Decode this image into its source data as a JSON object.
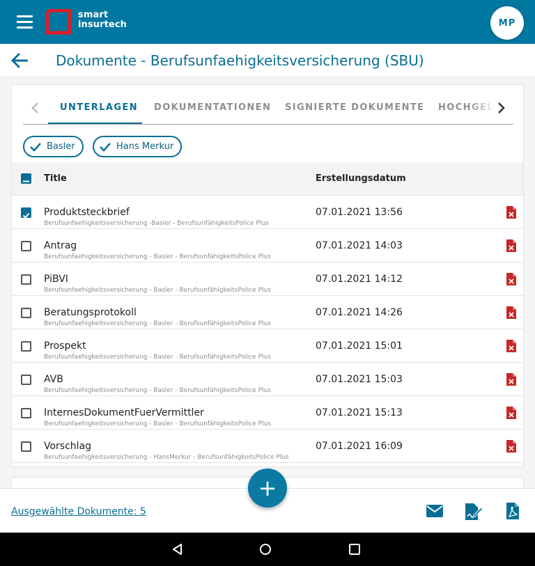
{
  "header": {
    "logo_line1": "smart",
    "logo_line2": "insurtech",
    "avatar_initials": "MP"
  },
  "page": {
    "title": "Dokumente - Berufsunfaehigkeitsversicherung (SBU)"
  },
  "tabs": [
    {
      "label": "UNTERLAGEN",
      "active": true
    },
    {
      "label": "DOKUMENTATIONEN",
      "active": false
    },
    {
      "label": "SIGNIERTE DOKUMENTE",
      "active": false
    },
    {
      "label": "HOCHGEL",
      "active": false
    }
  ],
  "filters": [
    {
      "label": "Basler",
      "checked": true
    },
    {
      "label": "Hans Merkur",
      "checked": true
    }
  ],
  "table": {
    "columns": {
      "title": "Title",
      "date": "Erstellungsdatum"
    },
    "rows": [
      {
        "title": "Produktsteckbrief",
        "subtitle": "Berufsunfaehigkeitsversicherung -Basler - BerufsunfähigkeitsPolice Plus",
        "date": "07.01.2021 13:56",
        "checked": true
      },
      {
        "title": "Antrag",
        "subtitle": "Berufsunfaehigkeitsversicherung - Basler - BerufsunfähigkeitsPolice Plus",
        "date": "07.01.2021 14:03",
        "checked": false
      },
      {
        "title": "PiBVI",
        "subtitle": "Berufsunfaehigkeitsversicherung - Basler - BerufsunfähigkeitsPolice Plus",
        "date": "07.01.2021 14:12",
        "checked": false
      },
      {
        "title": "Beratungsprotokoll",
        "subtitle": "Berufsunfaehigkeitsversicherung - Basler - BerufsunfähigkeitsPolice Plus",
        "date": "07.01.2021 14:26",
        "checked": false
      },
      {
        "title": "Prospekt",
        "subtitle": "Berufsunfaehigkeitsversicherung - Basler - BerufsunfähigkeitsPolice Plus",
        "date": "07.01.2021 15:01",
        "checked": false
      },
      {
        "title": "AVB",
        "subtitle": "Berufsunfaehigkeitsversicherung - Basler - BerufsunfähigkeitsPolice Plus",
        "date": "07.01.2021 15:03",
        "checked": false
      },
      {
        "title": "InternesDokumentFuerVermittler",
        "subtitle": "Berufsunfaehigkeitsversicherung - Basler - BerufsunfähigkeitsPolice Plus",
        "date": "07.01.2021 15:13",
        "checked": false
      },
      {
        "title": "Vorschlag",
        "subtitle": "Berufsunfaehigkeitsversicherung - HansMerkur - BerufsunfähigkeitsPolice Plus",
        "date": "07.01.2021 16:09",
        "checked": false
      }
    ]
  },
  "footer": {
    "selected_label": "Ausgewählte Dokumente: 5",
    "fab_symbol": "+"
  },
  "colors": {
    "primary": "#0077a0",
    "accent_text": "#0a6e94",
    "pdf_red": "#c62828"
  }
}
